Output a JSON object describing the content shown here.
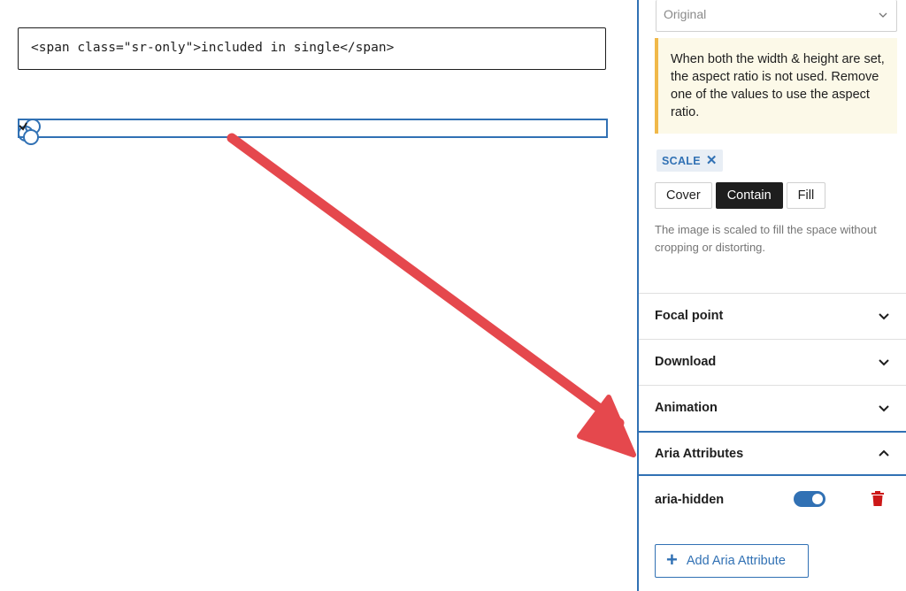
{
  "canvas": {
    "code_block": "<span class=\"sr-only\">included in single</span>",
    "image_placeholder_icon": "image-placeholder-icon"
  },
  "sidebar": {
    "aspect_select": {
      "value": "Original"
    },
    "notice": "When both the width & height are set, the aspect ratio is not used. Remove one of the values to use the aspect ratio.",
    "scale": {
      "tag_label": "SCALE",
      "tag_remove": "✕",
      "options": [
        "Cover",
        "Contain",
        "Fill"
      ],
      "selected": "Contain",
      "help": "The image is scaled to fill the space without cropping or distorting."
    },
    "panels": [
      {
        "title": "Focal point",
        "open": false
      },
      {
        "title": "Download",
        "open": false
      },
      {
        "title": "Animation",
        "open": false
      },
      {
        "title": "Aria Attributes",
        "open": true
      }
    ],
    "aria": {
      "attribute": "aria-hidden",
      "enabled": true,
      "add_label": "Add Aria Attribute",
      "add_icon": "+"
    }
  },
  "colors": {
    "accent": "#3171b4",
    "arrow": "#e5484d",
    "notice_bg": "#fcf9e8",
    "notice_border": "#f0b849",
    "delete": "#cc1818"
  }
}
